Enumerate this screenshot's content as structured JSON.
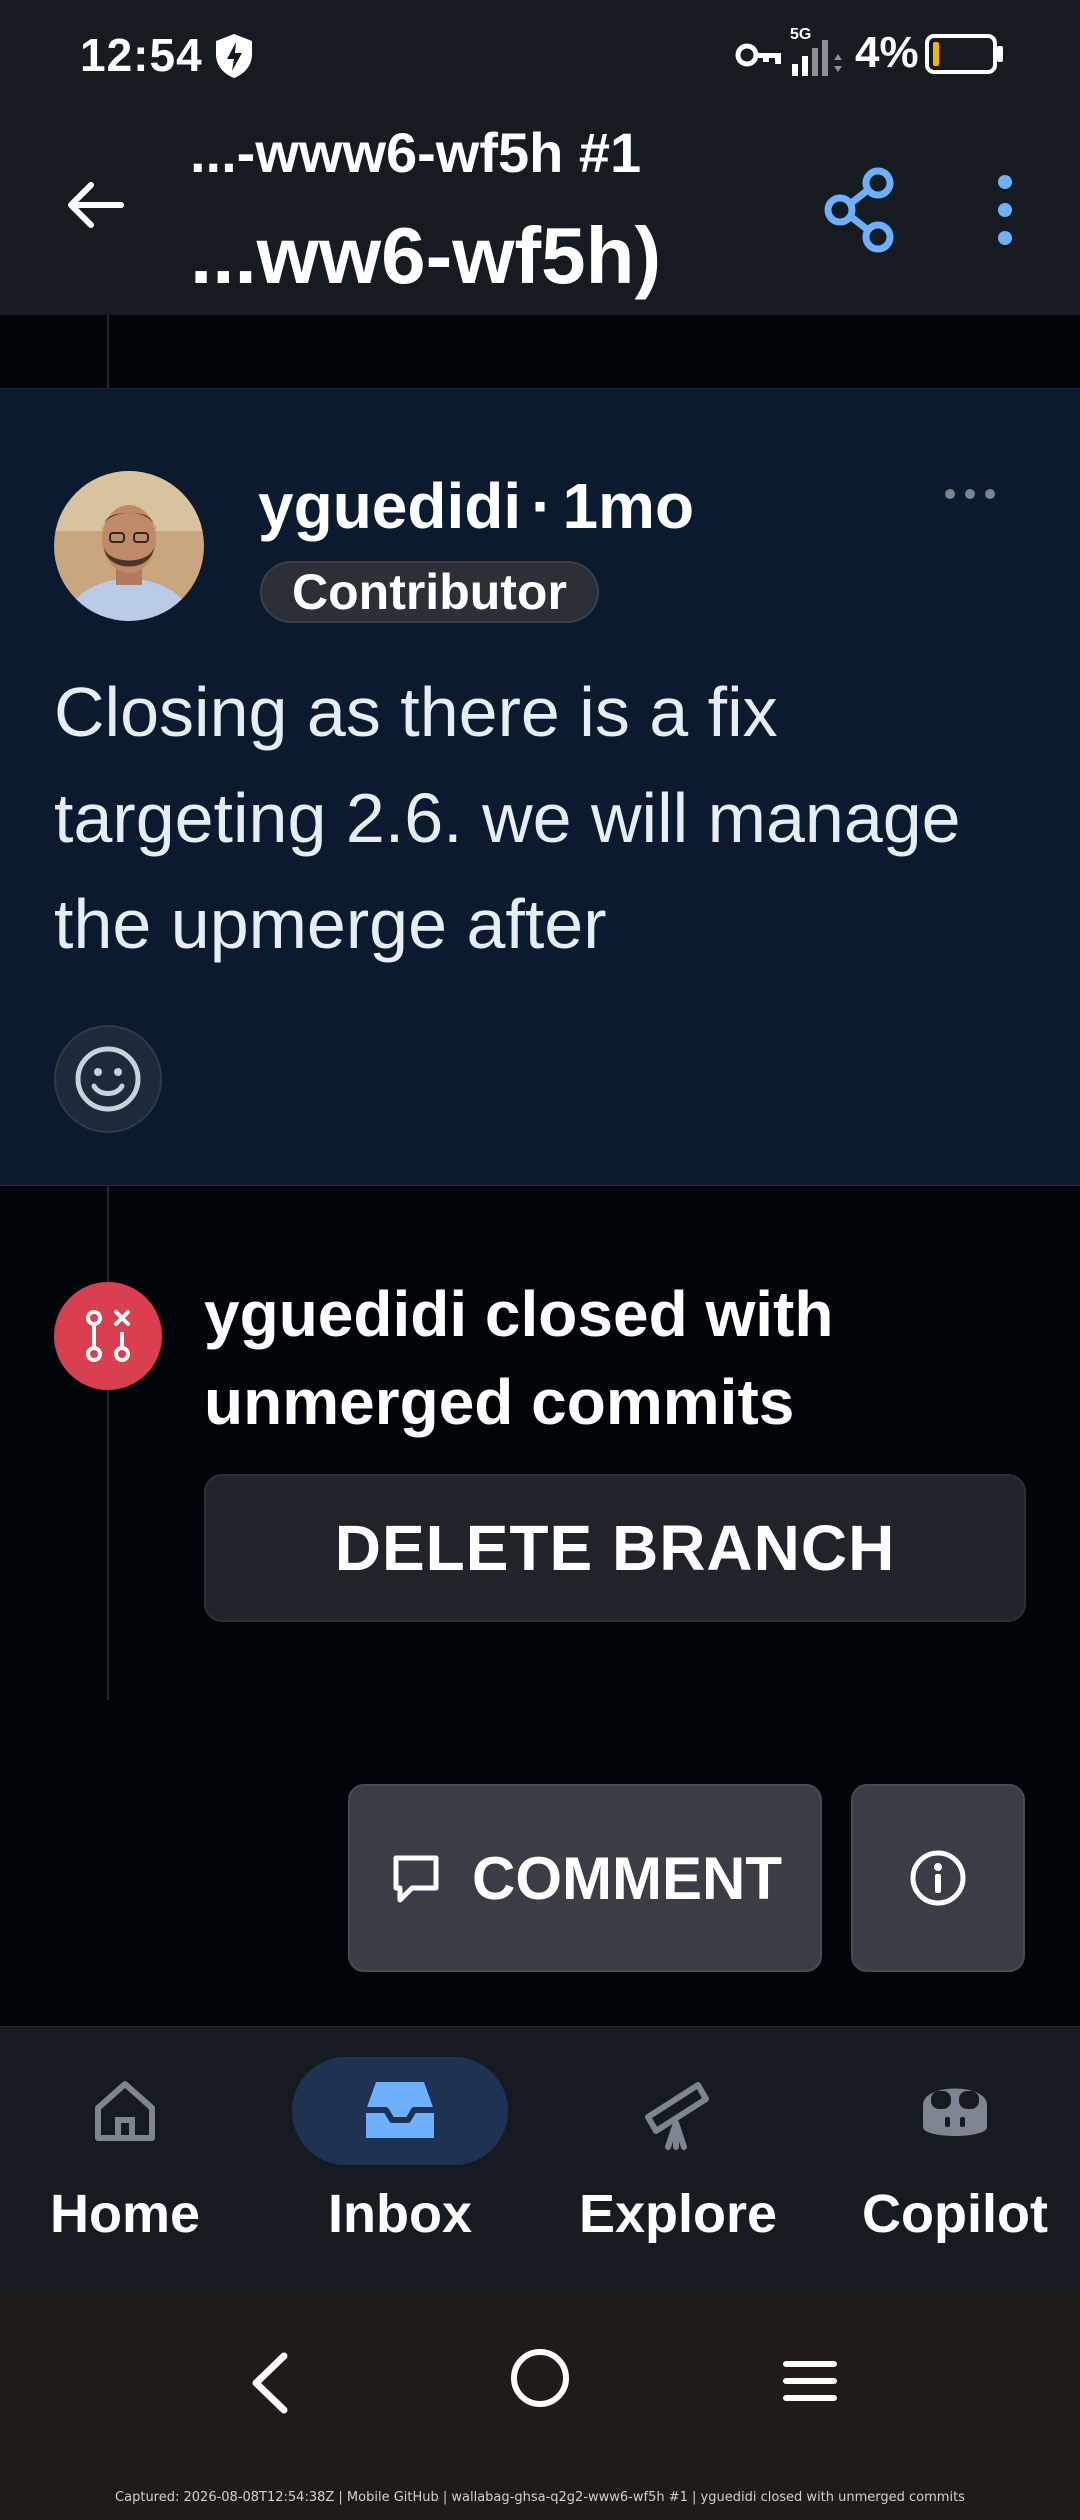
{
  "status_bar": {
    "time": "12:54",
    "network": "5G",
    "battery": "4%",
    "icons": [
      "shield-icon",
      "vpn-key-icon",
      "signal-icon",
      "battery-icon"
    ],
    "battery_color": "#f2b600"
  },
  "app_bar": {
    "title_line1": "...-www6-wf5h #1",
    "title_line2": "...ww6-wf5h)",
    "accent": "#6cb0ff"
  },
  "comment": {
    "author": "yguedidi",
    "separator": "·",
    "age": "1mo",
    "role": "Contributor",
    "body": "Closing as there is a fix targeting 2.6. we will manage the upmerge after"
  },
  "event": {
    "text": "yguedidi closed with unmerged commits",
    "button": "DELETE BRANCH",
    "icon_color": "#da3f4f"
  },
  "actions": {
    "comment_label": "COMMENT"
  },
  "bottom_nav": {
    "items": [
      {
        "label": "Home",
        "icon": "home-icon"
      },
      {
        "label": "Inbox",
        "icon": "inbox-icon",
        "active": true
      },
      {
        "label": "Explore",
        "icon": "telescope-icon"
      },
      {
        "label": "Copilot",
        "icon": "copilot-icon"
      }
    ]
  },
  "caption": "Captured: 2026-08-08T12:54:38Z | Mobile GitHub | wallabag-ghsa-q2g2-www6-wf5h #1 | yguedidi closed with unmerged commits"
}
